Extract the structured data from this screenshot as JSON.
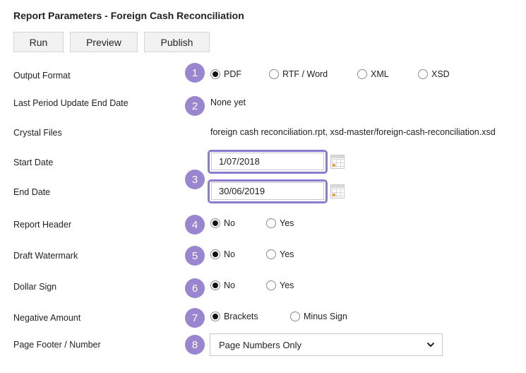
{
  "title": "Report Parameters - Foreign Cash Reconciliation",
  "toolbar": {
    "run": "Run",
    "preview": "Preview",
    "publish": "Publish"
  },
  "badges": [
    "1",
    "2",
    "3",
    "4",
    "5",
    "6",
    "7",
    "8"
  ],
  "output_format": {
    "label": "Output Format",
    "options": [
      "PDF",
      "RTF / Word",
      "XML",
      "XSD"
    ],
    "selected": "PDF"
  },
  "last_period": {
    "label": "Last Period Update End Date",
    "value": "None yet"
  },
  "crystal_files": {
    "label": "Crystal Files",
    "value": "foreign cash reconciliation.rpt, xsd-master/foreign-cash-reconciliation.xsd"
  },
  "start_date": {
    "label": "Start Date",
    "value": "1/07/2018"
  },
  "end_date": {
    "label": "End Date",
    "value": "30/06/2019"
  },
  "report_header": {
    "label": "Report Header",
    "options": [
      "No",
      "Yes"
    ],
    "selected": "No"
  },
  "draft_watermark": {
    "label": "Draft Watermark",
    "options": [
      "No",
      "Yes"
    ],
    "selected": "No"
  },
  "dollar_sign": {
    "label": "Dollar Sign",
    "options": [
      "No",
      "Yes"
    ],
    "selected": "No"
  },
  "negative_amount": {
    "label": "Negative Amount",
    "options": [
      "Brackets",
      "Minus Sign"
    ],
    "selected": "Brackets"
  },
  "page_footer": {
    "label": "Page Footer / Number",
    "value": "Page Numbers Only"
  },
  "colors": {
    "badge": "#9a85d1",
    "highlight_border": "#8d7bd0",
    "button_bg": "#f2f2f2"
  },
  "icons": {
    "calendar": "calendar-icon",
    "dropdown": "chevron-down-icon"
  }
}
